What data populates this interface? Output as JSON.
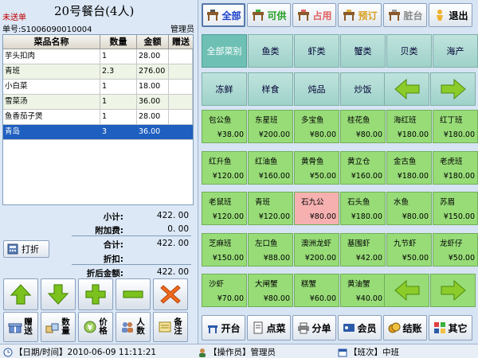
{
  "order": {
    "status": "未送单",
    "table_title": "20号餐台(4人)",
    "order_no": "单号:S1006090010004",
    "operator": "管理员"
  },
  "grid": {
    "headers": [
      "菜品名称",
      "数量",
      "金额",
      "赠送"
    ],
    "rows": [
      {
        "name": "芋头扣肉",
        "qty": "1",
        "amount": "28.00",
        "gift": ""
      },
      {
        "name": "青班",
        "qty": "2.3",
        "amount": "276.00",
        "gift": ""
      },
      {
        "name": "小白菜",
        "qty": "1",
        "amount": "18.00",
        "gift": ""
      },
      {
        "name": "雪菜汤",
        "qty": "1",
        "amount": "36.00",
        "gift": ""
      },
      {
        "name": "鱼香茄子煲",
        "qty": "1",
        "amount": "28.00",
        "gift": ""
      },
      {
        "name": "青岛",
        "qty": "3",
        "amount": "36.00",
        "gift": ""
      }
    ],
    "selected_index": 5
  },
  "summary": {
    "subtotal_label": "小计:",
    "subtotal": "422. 00",
    "surcharge_label": "附加费:",
    "surcharge": "0. 00",
    "total_label": "合计:",
    "total": "422. 00",
    "discount_label": "折扣:",
    "discount": "",
    "after_discount_label": "折后金额:",
    "after_discount": "422. 00"
  },
  "left_buttons": {
    "discount": "打折",
    "gift": "赠送",
    "qty": "数量",
    "price": "价格",
    "people": "人数",
    "remark": "备注"
  },
  "top_buttons": [
    {
      "name": "all",
      "label": "全部",
      "color": "#1a3fcc"
    },
    {
      "name": "available",
      "label": "可供",
      "color": "#1e9e1e"
    },
    {
      "name": "occupied",
      "label": "占用",
      "color": "#e06060"
    },
    {
      "name": "reserved",
      "label": "预订",
      "color": "#d8a020"
    },
    {
      "name": "dirty",
      "label": "脏台",
      "color": "#8a8a8a"
    },
    {
      "name": "exit",
      "label": "退出",
      "color": "#000000"
    }
  ],
  "categories": [
    "全部菜别",
    "鱼类",
    "虾类",
    "蟹类",
    "贝类",
    "海产",
    "冻鲜",
    "样食",
    "炖品",
    "炒饭"
  ],
  "dishes": [
    {
      "name": "包公鱼",
      "price": "¥38.00"
    },
    {
      "name": "东星班",
      "price": "¥200.00"
    },
    {
      "name": "多宝鱼",
      "price": "¥80.00"
    },
    {
      "name": "桂花鱼",
      "price": "¥80.00"
    },
    {
      "name": "海红班",
      "price": "¥180.00"
    },
    {
      "name": "红丁班",
      "price": "¥180.00"
    },
    {
      "name": "红升鱼",
      "price": "¥120.00"
    },
    {
      "name": "红油鱼",
      "price": "¥160.00"
    },
    {
      "name": "黄骨鱼",
      "price": "¥50.00"
    },
    {
      "name": "黄立仓",
      "price": "¥160.00"
    },
    {
      "name": "金古鱼",
      "price": "¥180.00"
    },
    {
      "name": "老虎班",
      "price": "¥180.00"
    },
    {
      "name": "老鼠班",
      "price": "¥120.00"
    },
    {
      "name": "青班",
      "price": "¥120.00"
    },
    {
      "name": "石九公",
      "price": "¥80.00"
    },
    {
      "name": "石头鱼",
      "price": "¥180.00"
    },
    {
      "name": "水鱼",
      "price": "¥80.00"
    },
    {
      "name": "苏眉",
      "price": "¥150.00"
    },
    {
      "name": "芝麻班",
      "price": "¥150.00"
    },
    {
      "name": "左口鱼",
      "price": "¥88.00"
    },
    {
      "name": "澳洲龙虾",
      "price": "¥200.00"
    },
    {
      "name": "基围虾",
      "price": "¥42.00"
    },
    {
      "name": "九节虾",
      "price": "¥50.00"
    },
    {
      "name": "龙虾仔",
      "price": "¥50.00"
    },
    {
      "name": "沙虾",
      "price": "¥70.00"
    },
    {
      "name": "大闸蟹",
      "price": "¥80.00"
    },
    {
      "name": "糕蟹",
      "price": "¥60.00"
    },
    {
      "name": "黄油蟹",
      "price": "¥40.00"
    }
  ],
  "func_buttons": [
    "开台",
    "点菜",
    "分单",
    "会员",
    "结账",
    "其它"
  ],
  "status_bar": {
    "datetime": "【日期/时间】2010-06-09 11:11:21",
    "operator": "【操作员】管理员",
    "shift": "【班次】中班"
  },
  "colors": {
    "dish_bg": "#98dc78",
    "dish_highlight": "#f6b0b0",
    "selected_row": "#1f5fbf",
    "category_bg": "#9fd2ca",
    "arrow_green": "#8ccc2a"
  }
}
